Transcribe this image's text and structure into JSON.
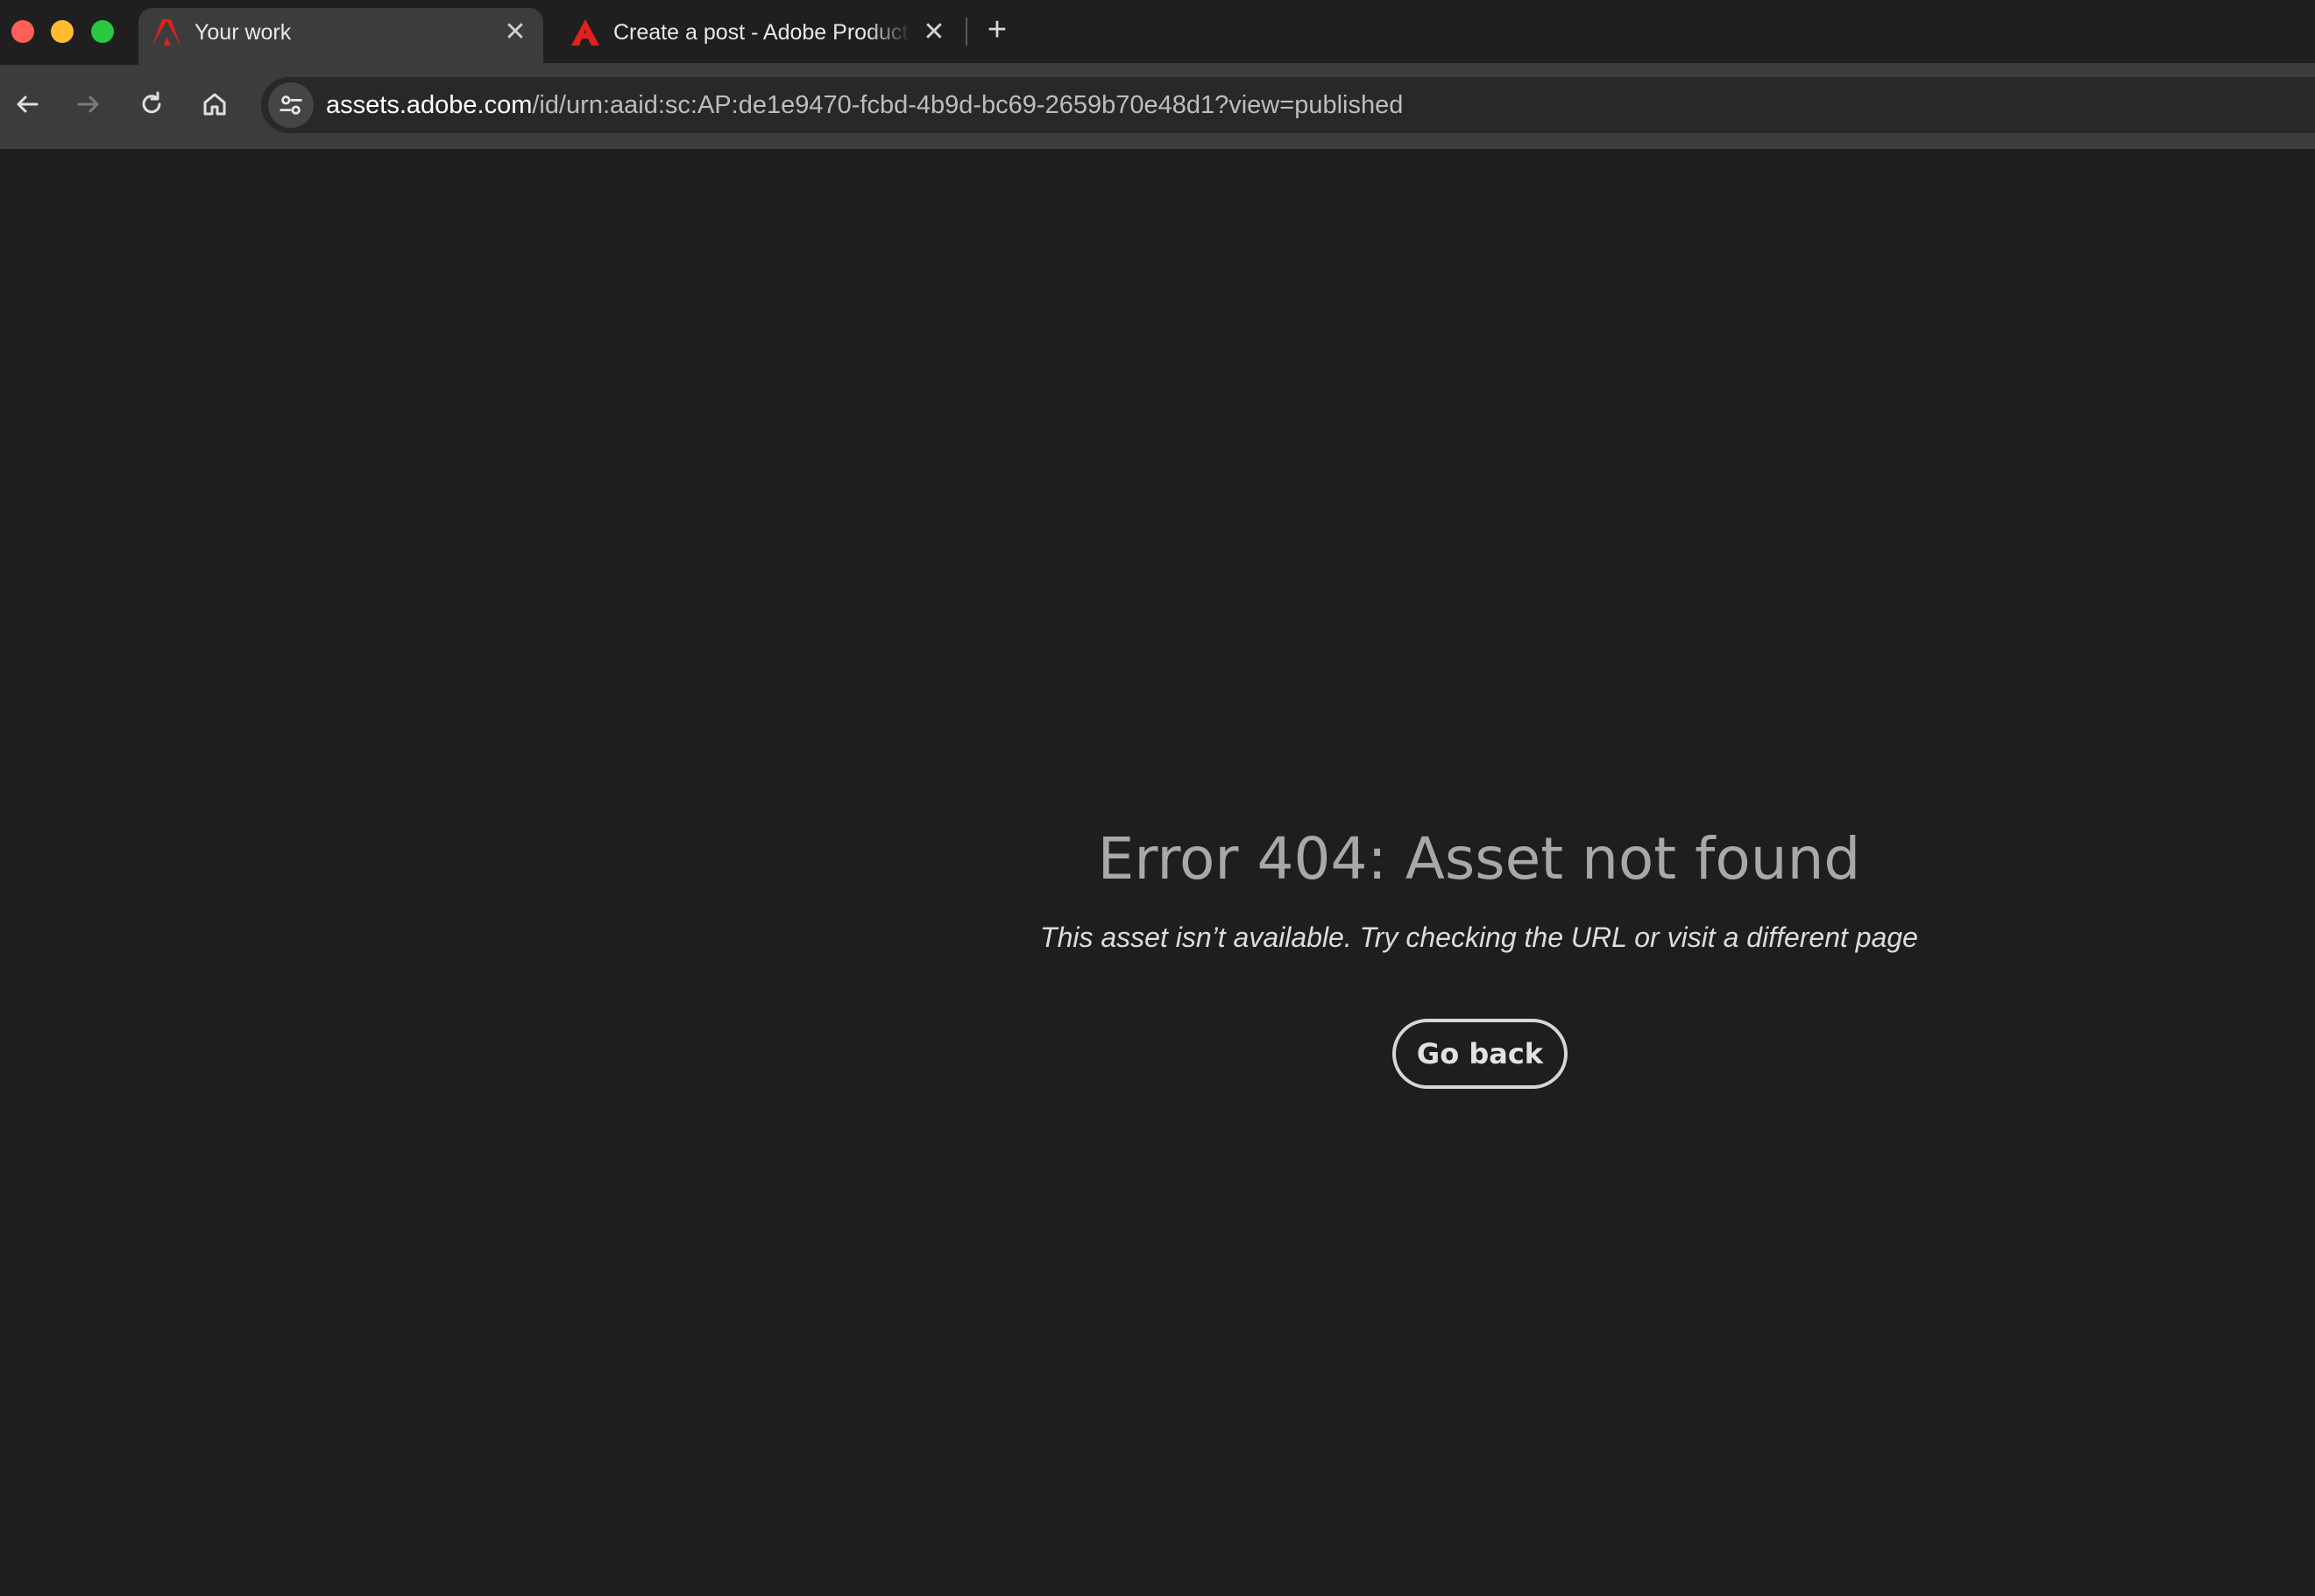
{
  "window": {
    "controls": [
      "close",
      "minimize",
      "zoom"
    ]
  },
  "tabs": [
    {
      "label": "Your work",
      "active": true,
      "icon": "adobe-logo-icon",
      "icon_color": "#e3201b"
    },
    {
      "label": "Create a post - Adobe Product Community",
      "active": false,
      "icon": "adobe-acrobat-icon",
      "icon_color": "#e3201b"
    }
  ],
  "tabstrip": {
    "close_glyph": "✕",
    "new_tab_glyph": "+"
  },
  "toolbar": {
    "back_icon": "arrow-left-icon",
    "forward_icon": "arrow-right-icon",
    "reload_icon": "reload-icon",
    "home_icon": "home-icon"
  },
  "address": {
    "host": "assets.adobe.com",
    "path": "/id/urn:aaid:sc:AP:de1e9470-fcbd-4b9d-bc69-2659b70e48d1?view=published"
  },
  "page": {
    "title": "Error 404: Asset not found",
    "subtitle": "This asset isn’t available. Try checking the URL or visit a different page",
    "button_label": "Go back"
  },
  "colors": {
    "background": "#1e1e1e",
    "toolbar": "#3c3c3c",
    "adobe_red": "#e3201b"
  }
}
